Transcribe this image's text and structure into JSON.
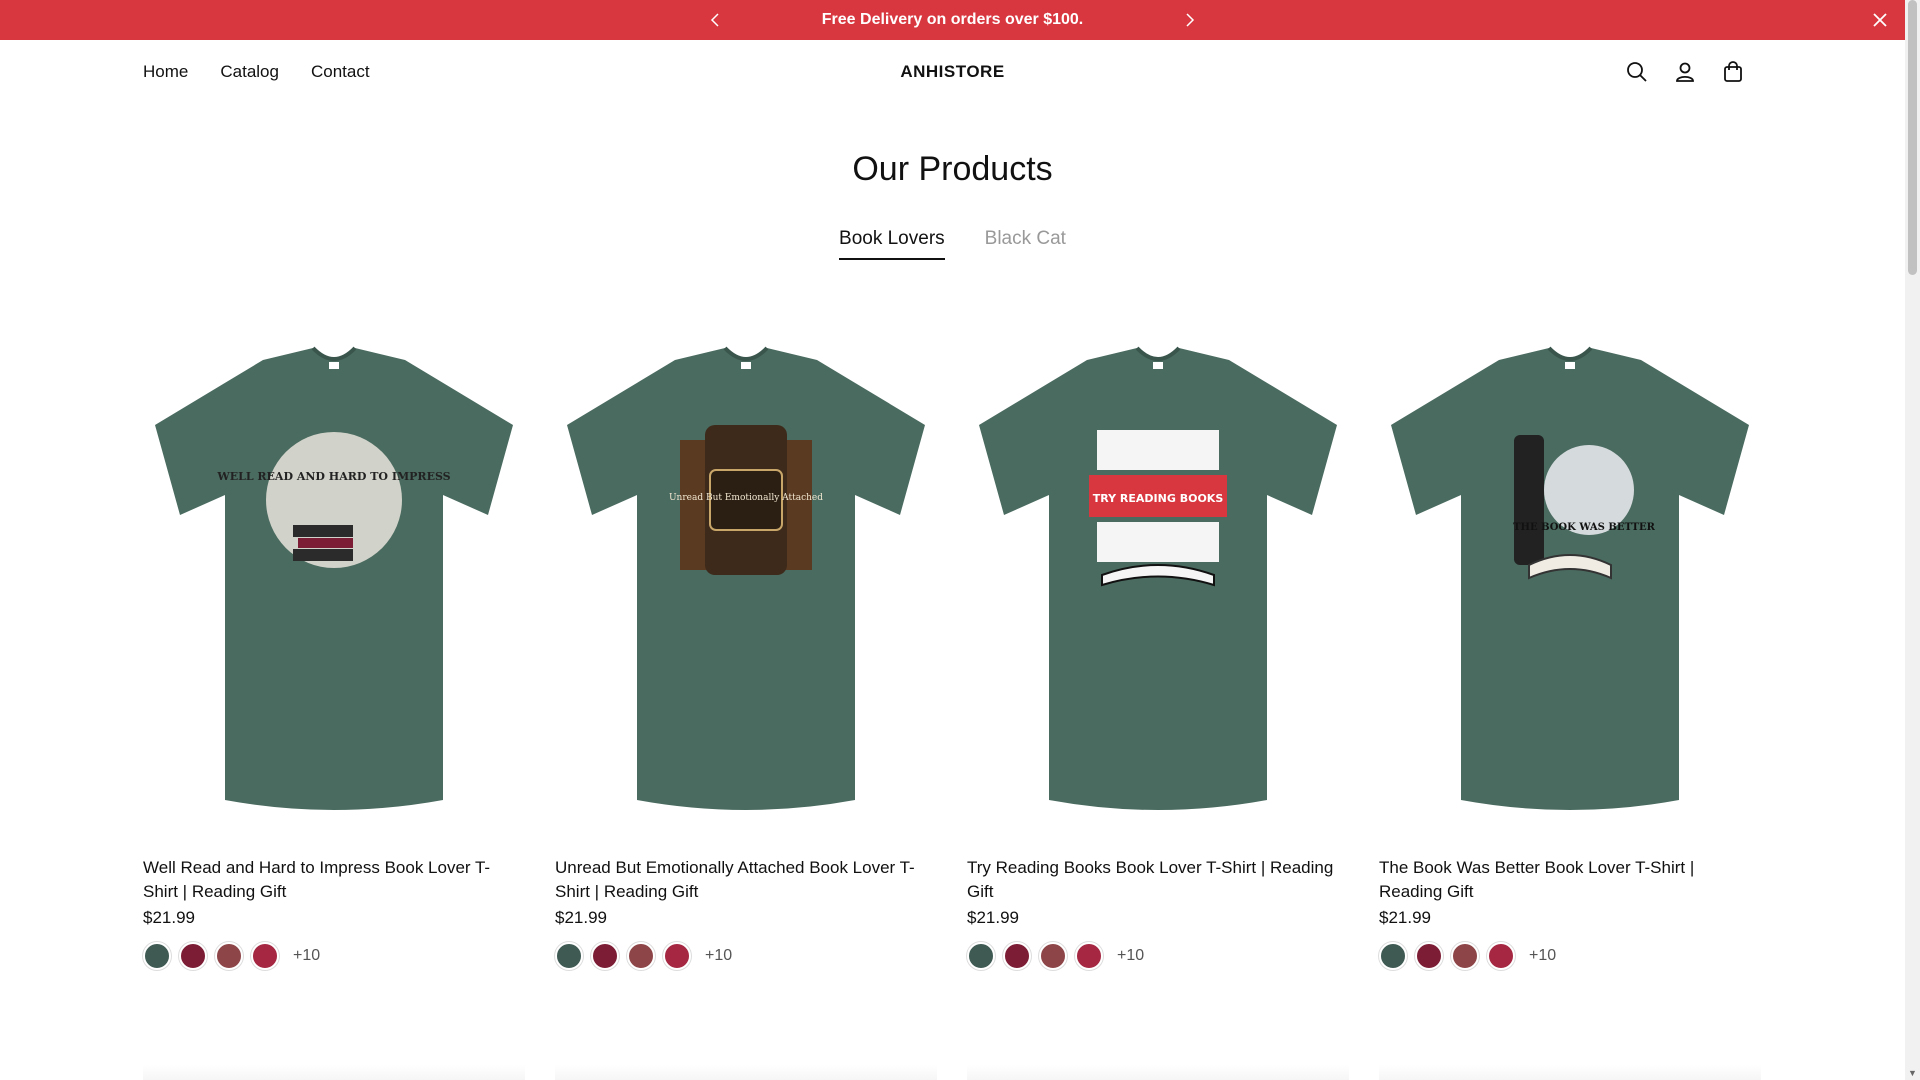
{
  "announcement": {
    "text": "Free Delivery on orders over $100."
  },
  "header": {
    "brand": "ANHISTORE",
    "nav": [
      "Home",
      "Catalog",
      "Contact"
    ]
  },
  "section": {
    "title": "Our Products",
    "tabs": [
      {
        "label": "Book Lovers",
        "active": true
      },
      {
        "label": "Black Cat",
        "active": false
      }
    ]
  },
  "products": [
    {
      "title": "Well Read and Hard to Impress Book Lover T-Shirt | Reading Gift",
      "price": "$21.99",
      "more": "+10",
      "swatches": [
        "#3e5a52",
        "#7d1d35",
        "#8e4548",
        "#a52742"
      ],
      "design_label": "WELL READ AND HARD TO IMPRESS"
    },
    {
      "title": "Unread But Emotionally Attached Book Lover T-Shirt | Reading Gift",
      "price": "$21.99",
      "more": "+10",
      "swatches": [
        "#3e5a52",
        "#7d1d35",
        "#8e4548",
        "#a52742"
      ],
      "design_label": "Unread But Emotionally Attached"
    },
    {
      "title": "Try Reading Books Book Lover T-Shirt | Reading Gift",
      "price": "$21.99",
      "more": "+10",
      "swatches": [
        "#3e5a52",
        "#7d1d35",
        "#8e4548",
        "#a52742"
      ],
      "design_label": "TRY READING BOOKS"
    },
    {
      "title": "The Book Was Better Book Lover T-Shirt | Reading Gift",
      "price": "$21.99",
      "more": "+10",
      "swatches": [
        "#3e5a52",
        "#7d1d35",
        "#8e4548",
        "#a52742"
      ],
      "design_label": "THE BOOK WAS BETTER"
    }
  ],
  "colors": {
    "announcement_bg": "#d8373f",
    "shirt": "#4a6b60"
  },
  "icons": [
    "chevron-left-icon",
    "chevron-right-icon",
    "close-icon",
    "search-icon",
    "account-icon",
    "cart-icon"
  ]
}
